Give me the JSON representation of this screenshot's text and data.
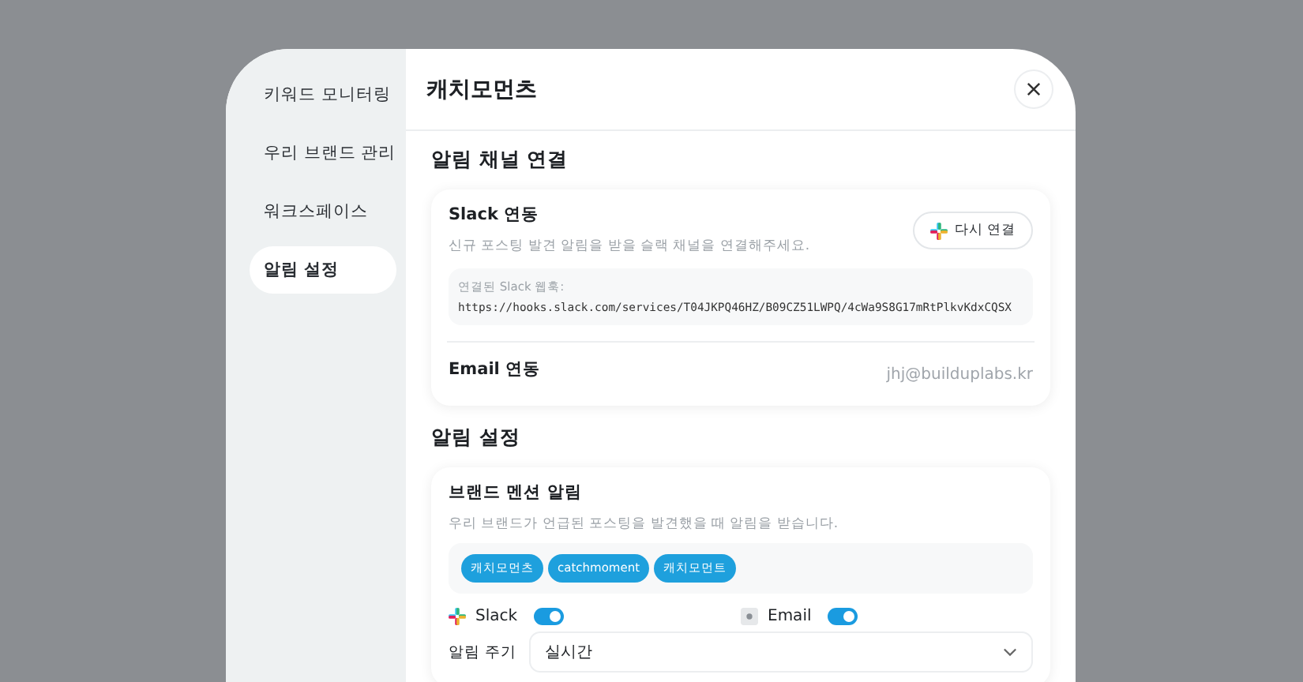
{
  "sidebar": {
    "items": [
      {
        "label": "키워드 모니터링",
        "selected": false
      },
      {
        "label": "우리 브랜드 관리",
        "selected": false
      },
      {
        "label": "워크스페이스",
        "selected": false
      },
      {
        "label": "알림 설정",
        "selected": true
      }
    ]
  },
  "header": {
    "title": "캐치모먼츠"
  },
  "channel_connection": {
    "title": "알림 채널 연결",
    "slack": {
      "title": "Slack 연동",
      "description": "신규 포스팅 발견 알림을 받을 슬랙 채널을 연결해주세요.",
      "button": "다시 연결",
      "webhook_label": "연결된 Slack 웹훅:",
      "webhook_url": "https://hooks.slack.com/services/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"
    },
    "email": {
      "title": "Email 연동",
      "value": "jhj@builduplabs.kr"
    }
  },
  "alert_settings": {
    "title": "알림 설정",
    "brand_mention": {
      "title": "브랜드 멘션 알림",
      "description": "우리 브랜드가 언급된 포스팅을 발견했을 때 알림을 받습니다.",
      "tags": [
        "캐치모먼츠",
        "catchmoment",
        "캐치모먼트"
      ],
      "channels": [
        {
          "kind": "slack",
          "label": "Slack",
          "on": true
        },
        {
          "kind": "email",
          "label": "Email",
          "on": true
        }
      ],
      "frequency": {
        "label": "알림 주기",
        "value": "실시간"
      }
    }
  }
}
